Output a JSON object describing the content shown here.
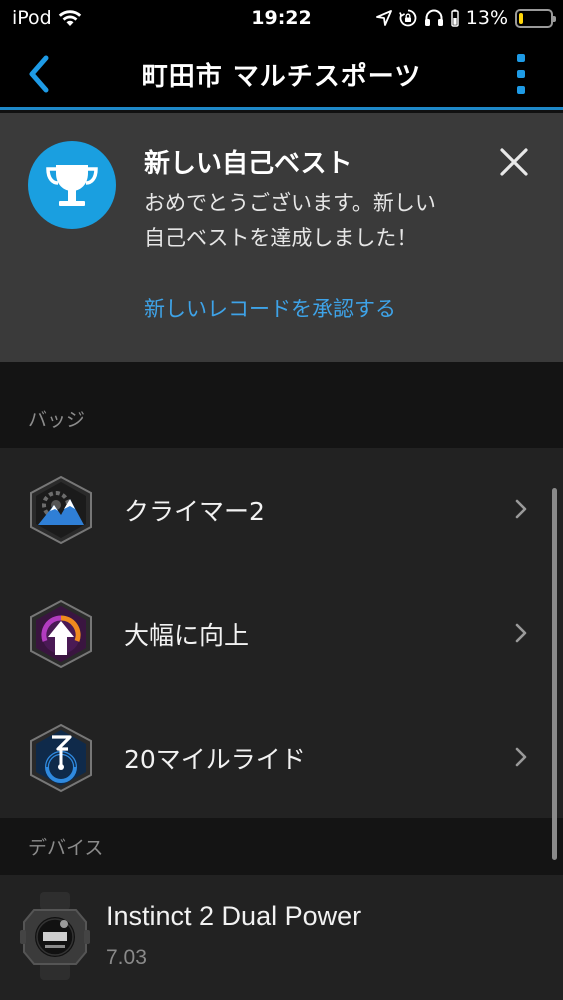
{
  "status_bar": {
    "carrier": "iPod",
    "time": "19:22",
    "battery_percent": "13%",
    "battery_level": 0.13,
    "battery_color": "#ffd60a"
  },
  "nav": {
    "title": "町田市 マルチスポーツ",
    "accent_color": "#1e88c8"
  },
  "personal_record_card": {
    "title": "新しい自己ベスト",
    "body": "おめでとうございます。新しい自己ベストを達成しました！",
    "link_label": "新しいレコードを承認する",
    "icon": "trophy-icon"
  },
  "badges": {
    "header": "バッジ",
    "items": [
      {
        "label": "クライマー2",
        "icon": "climber-badge-icon"
      },
      {
        "label": "大幅に向上",
        "icon": "big-improvement-badge-icon"
      },
      {
        "label": "20マイルライド",
        "icon": "20-mile-ride-badge-icon"
      }
    ]
  },
  "devices": {
    "header": "デバイス",
    "items": [
      {
        "name": "Instinct 2 Dual Power",
        "version": "7.03",
        "icon": "watch-icon"
      }
    ]
  }
}
